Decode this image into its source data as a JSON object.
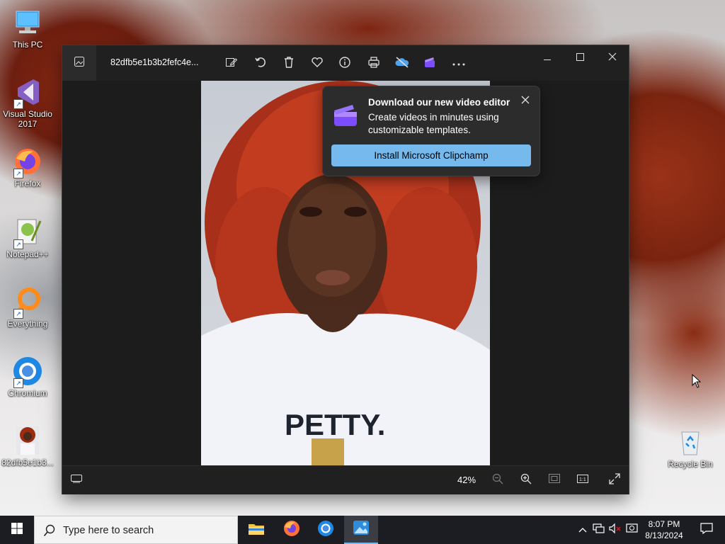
{
  "desktop": {
    "icons": [
      {
        "label": "This PC"
      },
      {
        "label": "Visual Studio 2017"
      },
      {
        "label": "Firefox"
      },
      {
        "label": "Notepad++"
      },
      {
        "label": "Everything"
      },
      {
        "label": "Chromium"
      },
      {
        "label": "82dfb5e1b3..."
      },
      {
        "label": "Recycle Bin"
      }
    ]
  },
  "photos": {
    "filename": "82dfb5e1b3b2fefc4e...",
    "toolbar_icons": [
      "gallery-icon",
      "edit-image-icon",
      "rotate-icon",
      "delete-icon",
      "favorite-icon",
      "info-icon",
      "print-icon",
      "onedrive-icon",
      "clipchamp-icon",
      "more-icon"
    ],
    "window_controls": [
      "minimize-icon",
      "maximize-icon",
      "close-icon"
    ],
    "photo_text": "PETTY.",
    "zoom_level": "42%",
    "teaching_tip": {
      "title": "Download our new video editor",
      "body": "Create videos in minutes using customizable templates.",
      "button": "Install Microsoft Clipchamp"
    }
  },
  "taskbar": {
    "search_placeholder": "Type here to search",
    "apps": [
      "file-explorer-icon",
      "firefox-icon",
      "chromium-icon",
      "photos-icon"
    ],
    "clock_time": "8:07 PM",
    "clock_date": "8/13/2024"
  },
  "colors": {
    "accent": "#76b9ed",
    "window_bg": "#202020",
    "taskbar_bg": "#1b1d22"
  }
}
